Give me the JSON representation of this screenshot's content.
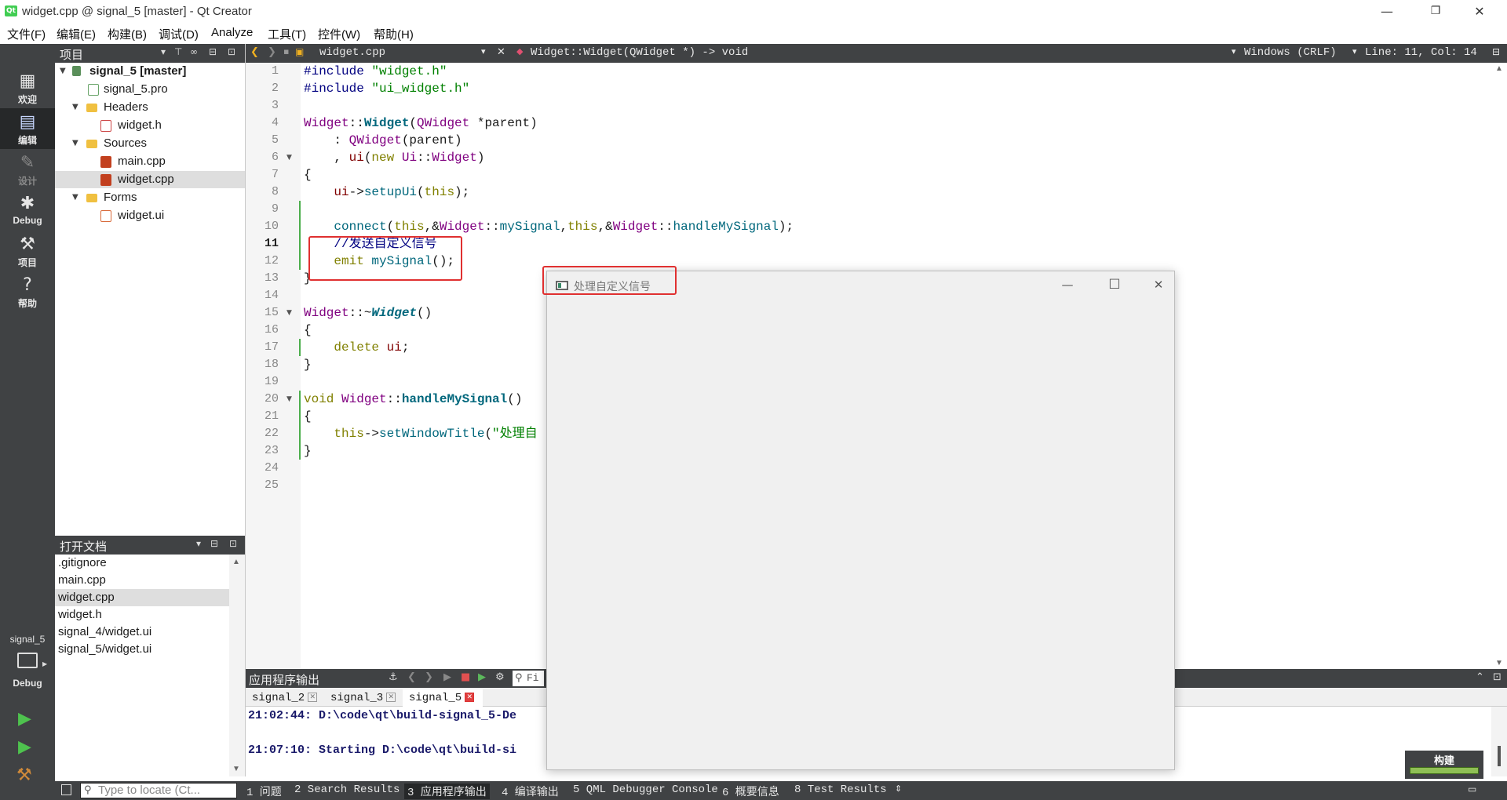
{
  "window": {
    "title": "widget.cpp @ signal_5 [master] - Qt Creator",
    "app_icon": "Qt",
    "minimize": "—",
    "maximize": "❐",
    "close": "✕"
  },
  "menu": [
    "文件(F)",
    "编辑(E)",
    "构建(B)",
    "调试(D)",
    "Analyze",
    "工具(T)",
    "控件(W)",
    "帮助(H)"
  ],
  "modes": [
    {
      "label": "欢迎",
      "icon": "grid-icon"
    },
    {
      "label": "编辑",
      "icon": "document-icon"
    },
    {
      "label": "设计",
      "icon": "pencil-icon"
    },
    {
      "label": "Debug",
      "icon": "bug-icon"
    },
    {
      "label": "项目",
      "icon": "wrench-icon"
    },
    {
      "label": "帮助",
      "icon": "help-icon"
    }
  ],
  "kit": {
    "project": "signal_5",
    "config": "Debug"
  },
  "project_pane": {
    "title": "项目",
    "tree": [
      {
        "label": "signal_5 [master]"
      },
      {
        "label": "signal_5.pro"
      },
      {
        "label": "Headers"
      },
      {
        "label": "widget.h"
      },
      {
        "label": "Sources"
      },
      {
        "label": "main.cpp"
      },
      {
        "label": "widget.cpp"
      },
      {
        "label": "Forms"
      },
      {
        "label": "widget.ui"
      }
    ]
  },
  "open_docs": {
    "title": "打开文档",
    "items": [
      ".gitignore",
      "main.cpp",
      "widget.cpp",
      "widget.h",
      "signal_4/widget.ui",
      "signal_5/widget.ui"
    ]
  },
  "editor_toolbar": {
    "file": "widget.cpp",
    "symbol": "Widget::Widget(QWidget *) -> void",
    "line_ending": "Windows (CRLF)",
    "position": "Line: 11, Col: 14"
  },
  "code": {
    "line_numbers": [
      "1",
      "2",
      "3",
      "4",
      "5",
      "6",
      "7",
      "8",
      "9",
      "10",
      "11",
      "12",
      "13",
      "14",
      "15",
      "16",
      "17",
      "18",
      "19",
      "20",
      "21",
      "22",
      "23",
      "24",
      "25"
    ],
    "current_line": 11,
    "lines": [
      "#include \"widget.h\"",
      "#include \"ui_widget.h\"",
      "",
      "Widget::Widget(QWidget *parent)",
      "    : QWidget(parent)",
      "    , ui(new Ui::Widget)",
      "{",
      "    ui->setupUi(this);",
      "",
      "    connect(this,&Widget::mySignal,this,&Widget::handleMySignal);",
      "    //发送自定义信号",
      "    emit mySignal();",
      "}",
      "",
      "Widget::~Widget()",
      "{",
      "    delete ui;",
      "}",
      "",
      "void Widget::handleMySignal()",
      "{",
      "    this->setWindowTitle(\"处理自",
      "}",
      "",
      ""
    ]
  },
  "output": {
    "title": "应用程序输出",
    "filter_placeholder": "Fi",
    "tabs": [
      "signal_2",
      "signal_3",
      "signal_5"
    ],
    "lines": [
      "21:02:44: D:\\code\\qt\\build-signal_5-De",
      "21:07:10: Starting D:\\code\\qt\\build-si"
    ]
  },
  "build": {
    "label": "构建",
    "progress": 1.0
  },
  "status": {
    "locator_placeholder": "Type to locate (Ct...",
    "panes": [
      "1 问题",
      "2 Search Results",
      "3 应用程序输出",
      "4 编译输出",
      "5 QML Debugger Console",
      "6 概要信息",
      "8 Test Results"
    ]
  },
  "popup": {
    "title": "处理自定义信号",
    "minimize": "—",
    "maximize": "☐",
    "close": "✕"
  },
  "colors": {
    "highlight": "#e03030",
    "sidebar": "#404244",
    "active_mode": "#262829",
    "build_bar": "#8fbf55"
  }
}
